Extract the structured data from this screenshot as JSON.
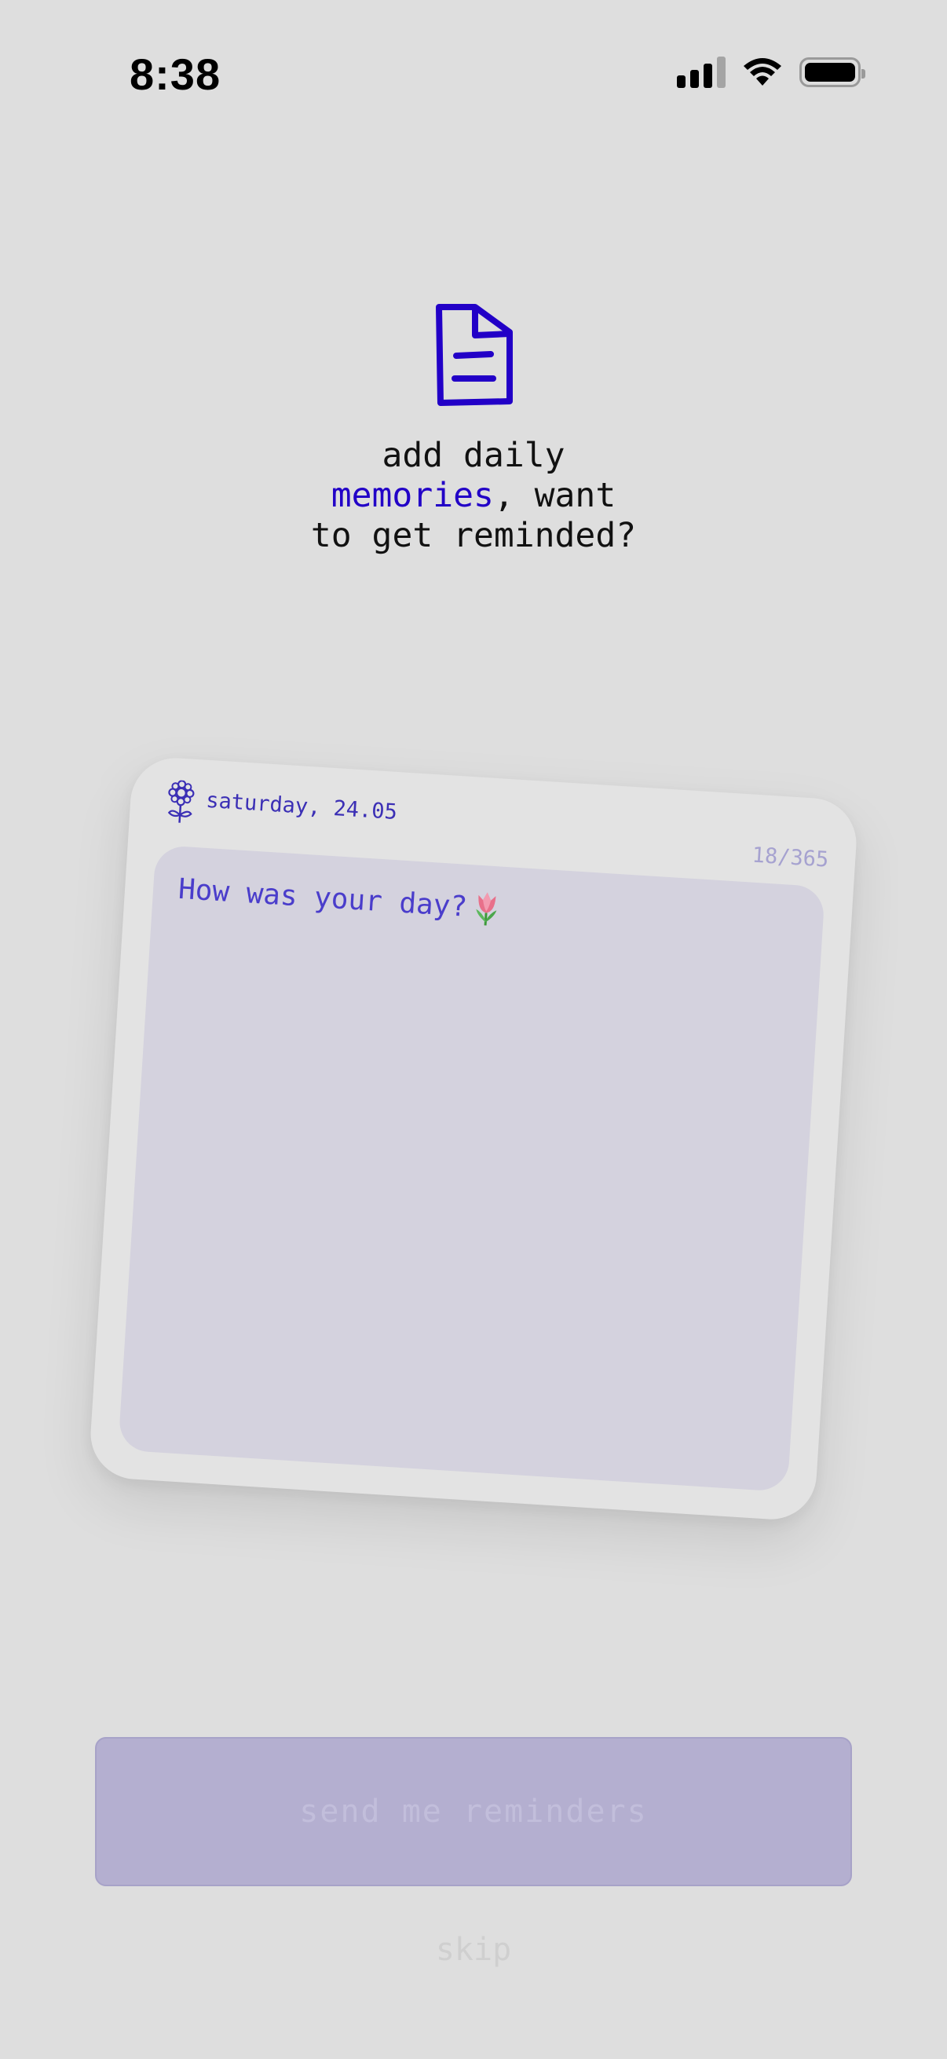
{
  "status_bar": {
    "time": "8:38"
  },
  "heading": {
    "line1": "add daily",
    "accent": "memories",
    "line2_rest": ", want",
    "line3": "to get reminded?"
  },
  "icons": {
    "doc": "document-icon",
    "flower": "flower-icon",
    "tulip": "tulip-emoji"
  },
  "card": {
    "date": "saturday, 24.05",
    "count": "18/365",
    "prompt": "How was your day?"
  },
  "actions": {
    "primary_label": "send me reminders",
    "secondary_label": "skip"
  },
  "colors": {
    "accent": "#2200c7",
    "card_text": "#3b2fb5",
    "button_bg": "#b4afd0"
  }
}
